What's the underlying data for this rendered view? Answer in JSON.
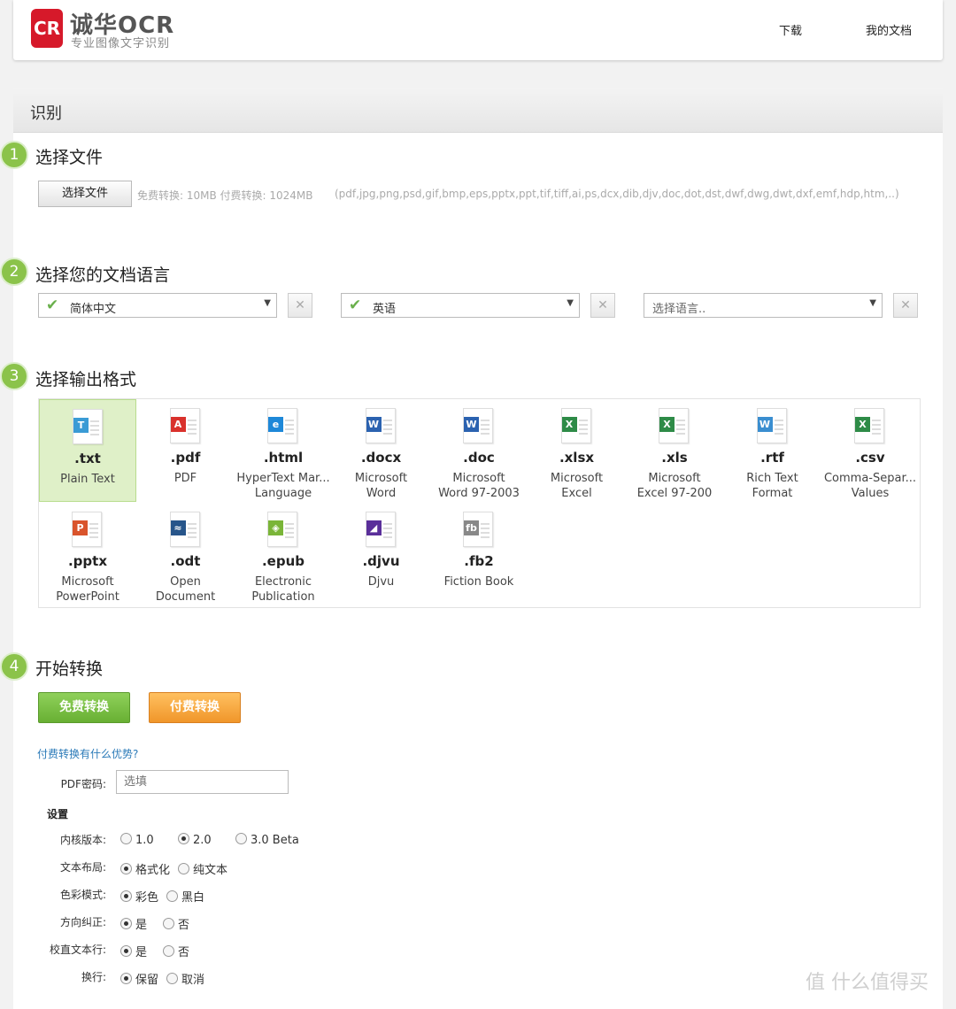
{
  "header": {
    "logo_mark": "CR",
    "logo_title": "诚华OCR",
    "logo_subtitle": "专业图像文字识别",
    "nav": [
      "下载",
      "我的文档"
    ]
  },
  "panel": {
    "title": "识别"
  },
  "steps": [
    {
      "num": "1",
      "title": "选择文件"
    },
    {
      "num": "2",
      "title": "选择您的文档语言"
    },
    {
      "num": "3",
      "title": "选择输出格式"
    },
    {
      "num": "4",
      "title": "开始转换"
    }
  ],
  "file": {
    "button_label": "选择文件",
    "limits": "免费转换: 10MB  付费转换: 1024MB",
    "types": "(pdf,jpg,png,psd,gif,bmp,eps,pptx,ppt,tif,tiff,ai,ps,dcx,dib,djv,doc,dot,dst,dwf,dwg,dwt,dxf,emf,hdp,htm,..)"
  },
  "languages": [
    {
      "value": "简体中文",
      "selected": true
    },
    {
      "value": "英语",
      "selected": true
    },
    {
      "value": "选择语言..",
      "selected": false
    }
  ],
  "formats": [
    {
      "ext": ".txt",
      "desc1": "Plain Text",
      "desc2": "",
      "icon": "text-file-icon",
      "badge": "T",
      "color": "#3a9bd5",
      "selected": true
    },
    {
      "ext": ".pdf",
      "desc1": "PDF",
      "desc2": "",
      "icon": "pdf-file-icon",
      "badge": "A",
      "color": "#d9312c",
      "selected": false
    },
    {
      "ext": ".html",
      "desc1": "HyperText Mar...",
      "desc2": "Language",
      "icon": "html-file-icon",
      "badge": "e",
      "color": "#1e88d8",
      "selected": false
    },
    {
      "ext": ".docx",
      "desc1": "Microsoft",
      "desc2": "Word",
      "icon": "word-file-icon",
      "badge": "W",
      "color": "#2b62b0",
      "selected": false
    },
    {
      "ext": ".doc",
      "desc1": "Microsoft",
      "desc2": "Word 97-2003",
      "icon": "word-file-icon",
      "badge": "W",
      "color": "#2b62b0",
      "selected": false
    },
    {
      "ext": ".xlsx",
      "desc1": "Microsoft",
      "desc2": "Excel",
      "icon": "excel-file-icon",
      "badge": "X",
      "color": "#2e8b47",
      "selected": false
    },
    {
      "ext": ".xls",
      "desc1": "Microsoft",
      "desc2": "Excel 97-200",
      "icon": "excel-file-icon",
      "badge": "X",
      "color": "#2e8b47",
      "selected": false
    },
    {
      "ext": ".rtf",
      "desc1": "Rich Text",
      "desc2": "Format",
      "icon": "rtf-file-icon",
      "badge": "W",
      "color": "#3a8ed0",
      "selected": false
    },
    {
      "ext": ".csv",
      "desc1": "Comma-Separ...",
      "desc2": "Values",
      "icon": "csv-file-icon",
      "badge": "X",
      "color": "#2e8b47",
      "selected": false
    },
    {
      "ext": ".pptx",
      "desc1": "Microsoft",
      "desc2": "PowerPoint",
      "icon": "powerpoint-file-icon",
      "badge": "P",
      "color": "#d9542c",
      "selected": false
    },
    {
      "ext": ".odt",
      "desc1": "Open",
      "desc2": "Document",
      "icon": "odt-file-icon",
      "badge": "≈",
      "color": "#27558a",
      "selected": false
    },
    {
      "ext": ".epub",
      "desc1": "Electronic",
      "desc2": "Publication",
      "icon": "epub-file-icon",
      "badge": "◈",
      "color": "#7ab538",
      "selected": false
    },
    {
      "ext": ".djvu",
      "desc1": "Djvu",
      "desc2": "",
      "icon": "djvu-file-icon",
      "badge": "◢",
      "color": "#5a2f9a",
      "selected": false
    },
    {
      "ext": ".fb2",
      "desc1": "Fiction Book",
      "desc2": "",
      "icon": "fb2-file-icon",
      "badge": "fb",
      "color": "#888888",
      "selected": false
    }
  ],
  "convert": {
    "free_label": "免费转换",
    "paid_label": "付费转换",
    "paid_link": "付费转换有什么优势?"
  },
  "pdf_password": {
    "label": "PDF密码:",
    "placeholder": "选填"
  },
  "settings": {
    "title": "设置",
    "rows": [
      {
        "label": "内核版本:",
        "options": [
          "1.0",
          "2.0",
          "3.0 Beta"
        ],
        "selected": 1
      },
      {
        "label": "文本布局:",
        "options": [
          "格式化",
          "纯文本"
        ],
        "selected": 0
      },
      {
        "label": "色彩模式:",
        "options": [
          "彩色",
          "黑白"
        ],
        "selected": 0
      },
      {
        "label": "方向纠正:",
        "options": [
          "是",
          "否"
        ],
        "selected": 0
      },
      {
        "label": "校直文本行:",
        "options": [
          "是",
          "否"
        ],
        "selected": 0
      },
      {
        "label": "换行:",
        "options": [
          "保留",
          "取消"
        ],
        "selected": 0
      }
    ]
  },
  "watermark": "值 什么值得买"
}
